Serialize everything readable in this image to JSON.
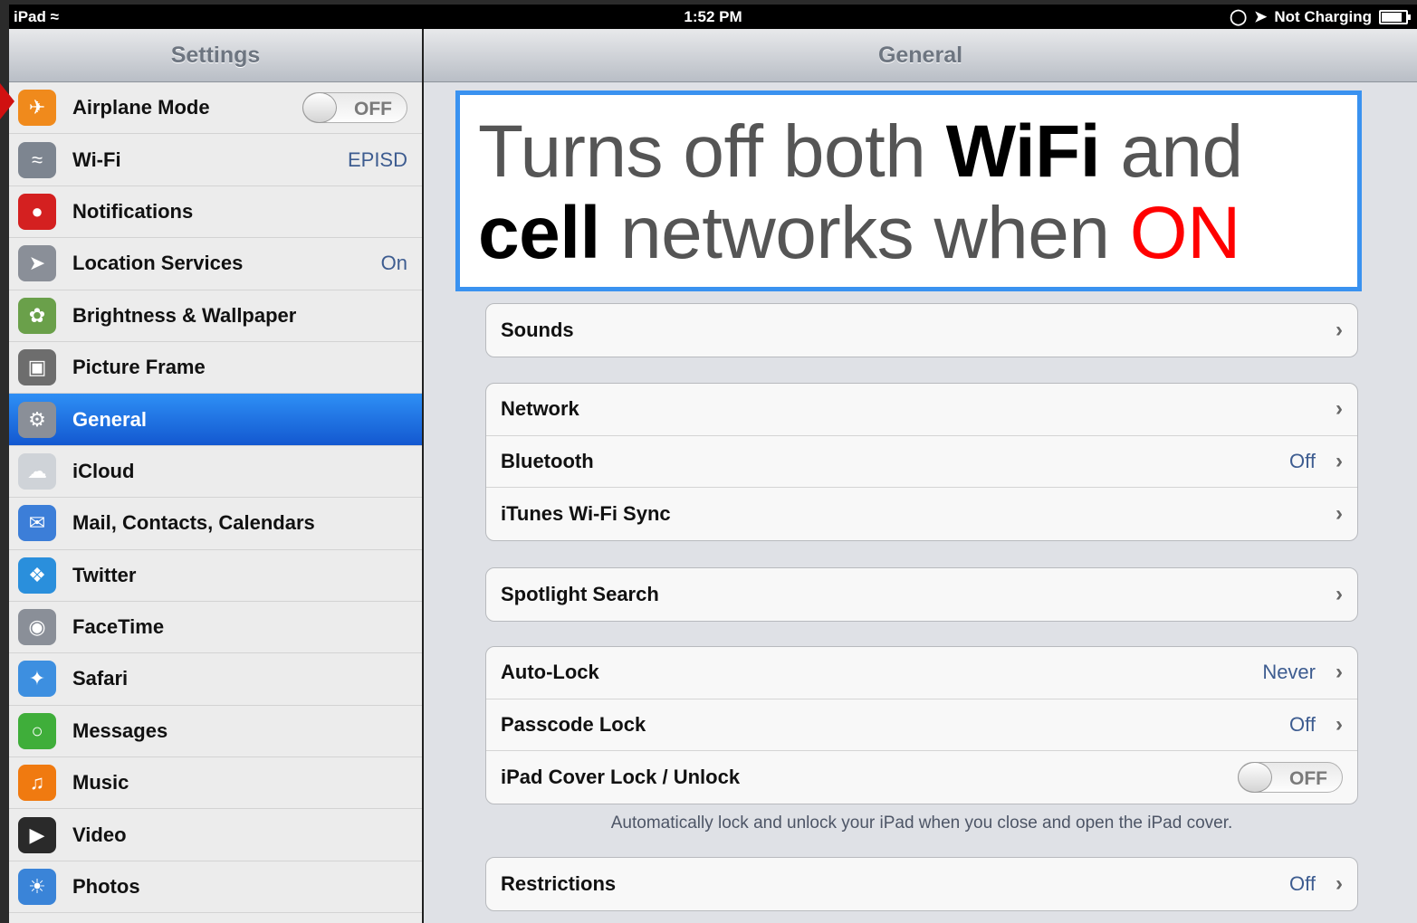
{
  "status": {
    "device": "iPad",
    "time": "1:52 PM",
    "charging": "Not Charging"
  },
  "left": {
    "title": "Settings",
    "items": [
      {
        "label": "Airplane Mode",
        "toggle": "OFF",
        "icon": "airplane-icon",
        "color": "#f08a1c"
      },
      {
        "label": "Wi-Fi",
        "value": "EPISD",
        "icon": "wifi-icon",
        "color": "#7d8590"
      },
      {
        "label": "Notifications",
        "icon": "notifications-icon",
        "color": "#d42020"
      },
      {
        "label": "Location Services",
        "value": "On",
        "icon": "location-icon",
        "color": "#8a8f98"
      },
      {
        "label": "Brightness & Wallpaper",
        "icon": "flower-icon",
        "color": "#6aa04a"
      },
      {
        "label": "Picture Frame",
        "icon": "picture-frame-icon",
        "color": "#6d6d6d"
      },
      {
        "label": "General",
        "icon": "gear-icon",
        "color": "#8a8f98",
        "selected": true
      },
      {
        "label": "iCloud",
        "icon": "cloud-icon",
        "color": "#cfd3d8"
      },
      {
        "label": "Mail, Contacts, Calendars",
        "icon": "mail-icon",
        "color": "#3c7ed8"
      },
      {
        "label": "Twitter",
        "icon": "twitter-icon",
        "color": "#2a8fdc"
      },
      {
        "label": "FaceTime",
        "icon": "facetime-icon",
        "color": "#8a8f98"
      },
      {
        "label": "Safari",
        "icon": "safari-icon",
        "color": "#3d8fe0"
      },
      {
        "label": "Messages",
        "icon": "messages-icon",
        "color": "#3fae3a"
      },
      {
        "label": "Music",
        "icon": "music-icon",
        "color": "#f07a10"
      },
      {
        "label": "Video",
        "icon": "video-icon",
        "color": "#2a2a2a"
      },
      {
        "label": "Photos",
        "icon": "photos-icon",
        "color": "#3a84d8"
      }
    ]
  },
  "right": {
    "title": "General",
    "callout": {
      "part1": "Turns off both ",
      "wifi": "WiFi",
      "part2": " and",
      "cell": "cell",
      "part3": " networks when ",
      "on": "ON"
    },
    "groups": [
      [
        {
          "label": "Sounds"
        }
      ],
      [
        {
          "label": "Network"
        },
        {
          "label": "Bluetooth",
          "value": "Off"
        },
        {
          "label": "iTunes Wi-Fi Sync"
        }
      ],
      [
        {
          "label": "Spotlight Search"
        }
      ],
      [
        {
          "label": "Auto-Lock",
          "value": "Never"
        },
        {
          "label": "Passcode Lock",
          "value": "Off"
        },
        {
          "label": "iPad Cover Lock / Unlock",
          "toggle": "OFF"
        }
      ],
      [
        {
          "label": "Restrictions",
          "value": "Off"
        }
      ]
    ],
    "footnote": "Automatically lock and unlock your iPad when you close and open the iPad cover."
  }
}
